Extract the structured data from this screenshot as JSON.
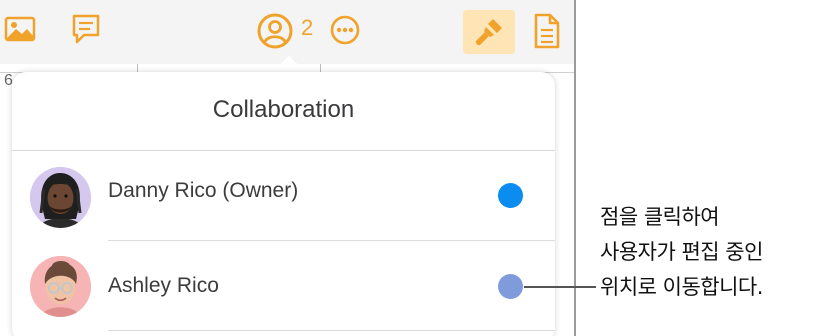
{
  "toolbar": {
    "icons": [
      "photo-icon",
      "comment-icon",
      "collaborator-icon",
      "more-icon",
      "format-brush-icon",
      "document-icon"
    ],
    "collaborator_count": "2",
    "accent_color": "#f0a22a",
    "format_button_bg": "#ffe4b6"
  },
  "ruler": {
    "marker": "6"
  },
  "popover": {
    "title": "Collaboration",
    "participants": [
      {
        "name": "Danny Rico (Owner)",
        "dot_color": "#0a8cf0",
        "avatar": "avatar-memoji-dreadlocks-icon"
      },
      {
        "name": "Ashley Rico",
        "dot_color": "#7f9bdc",
        "avatar": "avatar-memoji-glasses-icon"
      }
    ]
  },
  "callout": {
    "lines": [
      "점을 클릭하여",
      "사용자가 편집 중인",
      "위치로 이동합니다."
    ]
  }
}
